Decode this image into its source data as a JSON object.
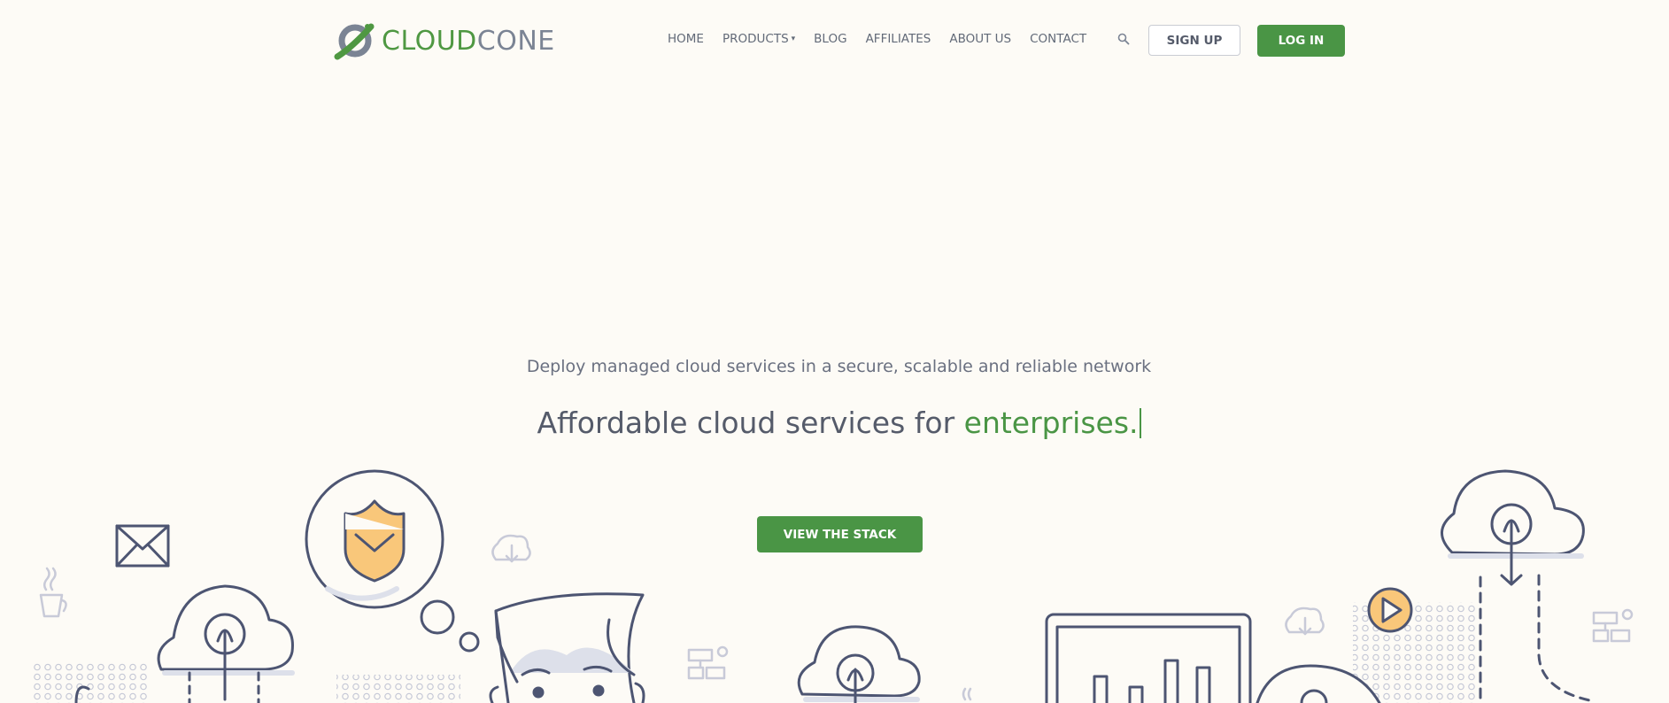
{
  "brand": {
    "name_part1": "CLOUD",
    "name_part2": "CONE",
    "logo_icon": "cloudcone-ring-logo"
  },
  "nav": {
    "items": [
      {
        "label": "HOME"
      },
      {
        "label": "PRODUCTS",
        "has_dropdown": true
      },
      {
        "label": "BLOG"
      },
      {
        "label": "AFFILIATES"
      },
      {
        "label": "ABOUT US"
      },
      {
        "label": "CONTACT"
      }
    ],
    "search_icon": "search-icon",
    "signup_label": "SIGN UP",
    "login_label": "LOG IN"
  },
  "hero": {
    "tagline": "Deploy managed cloud services in a secure, scalable and reliable network",
    "headline_prefix": "Affordable cloud services for ",
    "headline_accent": "enterprises.",
    "cta_label": "VIEW THE STACK"
  },
  "colors": {
    "background": "#fdfbf6",
    "brand_green": "#4a9545",
    "text_gray": "#555b6a",
    "line_art": "#4d5572",
    "accent_orange": "#f9c77a"
  }
}
